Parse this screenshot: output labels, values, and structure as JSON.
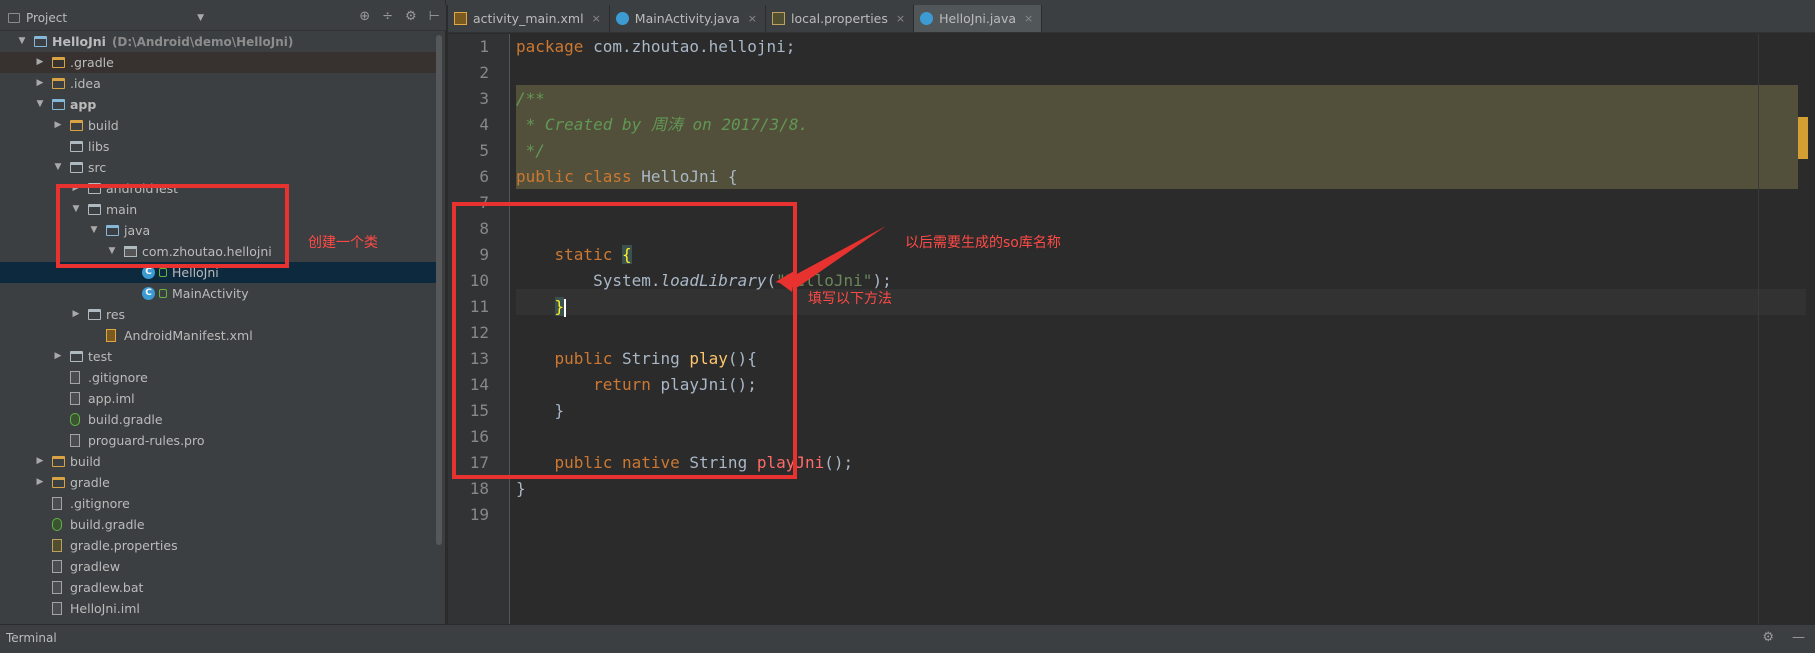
{
  "project_panel": {
    "title": "Project",
    "tree": [
      {
        "label": "HelloJni",
        "path": "(D:\\Android\\demo\\HelloJni)",
        "icon": "project-icon",
        "arrow": "▼"
      },
      {
        "label": ".gradle",
        "icon": "folder-icon",
        "arrow": "▶"
      },
      {
        "label": ".idea",
        "icon": "folder-icon",
        "arrow": "▶"
      },
      {
        "label": "app",
        "icon": "module-icon",
        "arrow": "▼"
      },
      {
        "label": "build",
        "icon": "folder-icon",
        "arrow": "▶"
      },
      {
        "label": "libs",
        "icon": "folder-icon",
        "arrow": ""
      },
      {
        "label": "src",
        "icon": "folder-icon",
        "arrow": "▼"
      },
      {
        "label": "androidTest",
        "icon": "folder-icon",
        "arrow": "▶"
      },
      {
        "label": "main",
        "icon": "folder-icon",
        "arrow": "▼"
      },
      {
        "label": "java",
        "icon": "folder-icon",
        "arrow": "▼"
      },
      {
        "label": "com.zhoutao.hellojni",
        "icon": "package-icon",
        "arrow": "▼"
      },
      {
        "label": "HelloJni",
        "icon": "class-icon",
        "arrow": ""
      },
      {
        "label": "MainActivity",
        "icon": "class-icon",
        "arrow": ""
      },
      {
        "label": "res",
        "icon": "folder-icon",
        "arrow": "▶"
      },
      {
        "label": "AndroidManifest.xml",
        "icon": "xml-file-icon",
        "arrow": ""
      },
      {
        "label": "test",
        "icon": "folder-icon",
        "arrow": "▶"
      },
      {
        "label": ".gitignore",
        "icon": "file-icon",
        "arrow": ""
      },
      {
        "label": "app.iml",
        "icon": "file-icon",
        "arrow": ""
      },
      {
        "label": "build.gradle",
        "icon": "gradle-file-icon",
        "arrow": ""
      },
      {
        "label": "proguard-rules.pro",
        "icon": "file-icon",
        "arrow": ""
      },
      {
        "label": "build",
        "icon": "folder-icon",
        "arrow": "▶"
      },
      {
        "label": "gradle",
        "icon": "folder-icon",
        "arrow": "▶"
      },
      {
        "label": ".gitignore",
        "icon": "file-icon",
        "arrow": ""
      },
      {
        "label": "build.gradle",
        "icon": "gradle-file-icon",
        "arrow": ""
      },
      {
        "label": "gradle.properties",
        "icon": "properties-file-icon",
        "arrow": ""
      },
      {
        "label": "gradlew",
        "icon": "file-icon",
        "arrow": ""
      },
      {
        "label": "gradlew.bat",
        "icon": "file-icon",
        "arrow": ""
      },
      {
        "label": "HelloJni.iml",
        "icon": "file-icon",
        "arrow": ""
      }
    ]
  },
  "tabs": [
    {
      "label": "activity_main.xml",
      "close": "×"
    },
    {
      "label": "MainActivity.java",
      "close": "×"
    },
    {
      "label": "local.properties",
      "close": "×"
    },
    {
      "label": "HelloJni.java",
      "close": "×"
    }
  ],
  "editor": {
    "line_numbers": [
      "1",
      "2",
      "3",
      "4",
      "5",
      "6",
      "7",
      "8",
      "9",
      "10",
      "11",
      "12",
      "13",
      "14",
      "15",
      "16",
      "17",
      "18",
      "19"
    ],
    "code": {
      "l1_kw": "package",
      "l1_rest": " com.zhoutao.hellojni;",
      "l3": "/**",
      "l4": " * Created by 周涛 on 2017/3/8.",
      "l5": " */",
      "l6_kw": "public class",
      "l6_rest": " HelloJni {",
      "l9_indent": "    ",
      "l9_kw": "static",
      "l9_brace": "{",
      "l10_a": "        System.",
      "l10_method": "loadLibrary",
      "l10_b": "(",
      "l10_str": "\"HelloJni\"",
      "l10_c": ");",
      "l11_indent": "    ",
      "l11_brace": "}",
      "l13_kw": "    public",
      "l13_type": " String ",
      "l13_fn": "play",
      "l13_rest": "(){",
      "l14_kw": "        return",
      "l14_rest": " playJni();",
      "l15": "    }",
      "l17_kw": "    public native",
      "l17_type": " String ",
      "l17_fn": "playJni",
      "l17_rest": "();",
      "l18": "}"
    }
  },
  "annotations": {
    "create_class": "创建一个类",
    "so_name": "以后需要生成的so库名称",
    "fill_method": "填写以下方法"
  },
  "statusbar": {
    "terminal": "Terminal",
    "settings_icon": "⚙",
    "minimize_icon": "—"
  },
  "header_tools": {
    "target": "⊕",
    "collapse": "÷",
    "settings": "⚙",
    "hide": "⊢"
  }
}
